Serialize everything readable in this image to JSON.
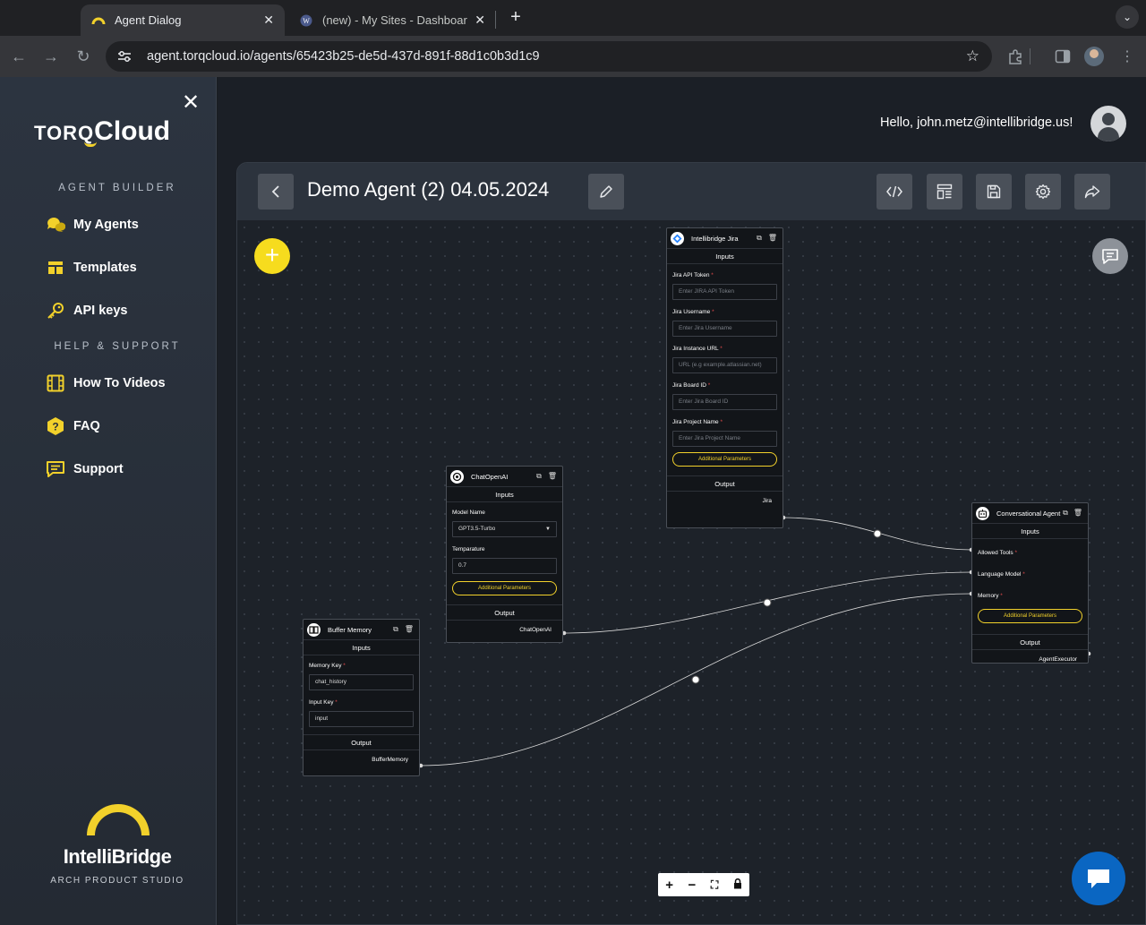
{
  "browser": {
    "tabs": [
      {
        "title": "Agent Dialog",
        "active": true
      },
      {
        "title": "(new) - My Sites - Dashboard",
        "active": false
      }
    ],
    "url": "agent.torqcloud.io/agents/65423b25-de5d-437d-891f-88d1c0b3d1c9"
  },
  "sidebar": {
    "logo": {
      "torq": "TORQ",
      "cloud": "Cloud"
    },
    "section_builder": "AGENT BUILDER",
    "builder_items": [
      {
        "label": "My Agents",
        "icon": "chat-bubbles-icon"
      },
      {
        "label": "Templates",
        "icon": "templates-icon"
      },
      {
        "label": "API keys",
        "icon": "key-icon"
      }
    ],
    "section_help": "HELP & SUPPORT",
    "help_items": [
      {
        "label": "How To Videos",
        "icon": "film-icon"
      },
      {
        "label": "FAQ",
        "icon": "question-hexagon-icon"
      },
      {
        "label": "Support",
        "icon": "support-chat-icon"
      }
    ],
    "brand": {
      "name": "IntelliBridge",
      "subtitle": "ARCH PRODUCT STUDIO"
    }
  },
  "header": {
    "greeting": "Hello, john.metz@intellibridge.us!"
  },
  "agent": {
    "title": "Demo Agent (2) 04.05.2024"
  },
  "nodes": {
    "jira": {
      "title": "Intellibridge Jira",
      "inputs_label": "Inputs",
      "fields": [
        {
          "label": "Jira API Token",
          "placeholder": "Enter JIRA API Token"
        },
        {
          "label": "Jira Username",
          "placeholder": "Enter Jira Username"
        },
        {
          "label": "Jira Instance URL",
          "placeholder": "URL (e.g example.atlassian.net)"
        },
        {
          "label": "Jira Board ID",
          "placeholder": "Enter Jira Board ID"
        },
        {
          "label": "Jira Project Name",
          "placeholder": "Enter Jira Project Name"
        }
      ],
      "additional": "Additional Parameters",
      "output_label": "Output",
      "output": "Jira"
    },
    "chat": {
      "title": "ChatOpenAI",
      "inputs_label": "Inputs",
      "model_label": "Model Name",
      "model_value": "GPT3.5-Turbo",
      "temp_label": "Temparature",
      "temp_value": "0.7",
      "additional": "Additional Parameters",
      "output_label": "Output",
      "output": "ChatOpenAI"
    },
    "buffer": {
      "title": "Buffer Memory",
      "inputs_label": "Inputs",
      "memkey_label": "Memory Key",
      "memkey_value": "chat_history",
      "inputkey_label": "Input Key",
      "inputkey_value": "input",
      "output_label": "Output",
      "output": "BufferMemory"
    },
    "conv": {
      "title": "Conversational Agent",
      "inputs_label": "Inputs",
      "allowed_tools": "Allowed Tools",
      "language_model": "Language Model",
      "memory": "Memory",
      "additional": "Additional Parameters",
      "output_label": "Output",
      "output": "AgentExecutor"
    }
  },
  "colors": {
    "accent": "#f6dc1e",
    "messenger": "#0a66c2"
  }
}
